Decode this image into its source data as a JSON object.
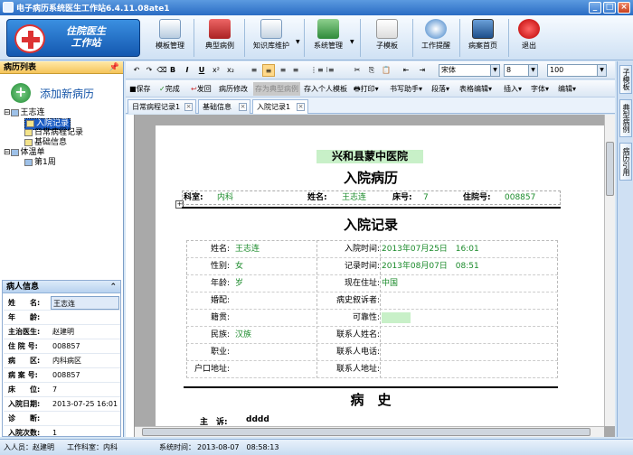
{
  "window": {
    "title": "电子病历系统医生工作站6.4.11.08ate1"
  },
  "logo": {
    "line1": "住院医生",
    "line2": "工作站"
  },
  "ribbon": [
    {
      "label": "模板管理",
      "icon": "template-manage-icon"
    },
    {
      "label": "典型病例",
      "icon": "typical-case-icon"
    },
    {
      "label": "知识库维护",
      "icon": "knowledge-base-icon"
    },
    {
      "label": "系统管理",
      "icon": "system-manage-icon"
    },
    {
      "label": "子模板",
      "icon": "sub-template-icon"
    },
    {
      "label": "工作提醒",
      "icon": "reminder-clock-icon"
    },
    {
      "label": "病案首页",
      "icon": "record-home-icon"
    },
    {
      "label": "退出",
      "icon": "exit-power-icon"
    }
  ],
  "side": {
    "header": "病历列表",
    "add_label": "添加新病历",
    "tree": [
      {
        "label": "王志连",
        "level": 0
      },
      {
        "label": "入院记录",
        "level": 1,
        "selected": true
      },
      {
        "label": "日常病程记录",
        "level": 1
      },
      {
        "label": "基础信息",
        "level": 1
      },
      {
        "label": "体温单",
        "level": 0
      },
      {
        "label": "第1周",
        "level": 1
      }
    ]
  },
  "patient": {
    "header": "病人信息",
    "rows": [
      {
        "k": "姓　　名:",
        "v": "王志连"
      },
      {
        "k": "年　　龄:",
        "v": ""
      },
      {
        "k": "主治医生:",
        "v": "赵建明"
      },
      {
        "k": "住 院 号:",
        "v": "008857"
      },
      {
        "k": "病　　区:",
        "v": "内科病区"
      },
      {
        "k": "病 案 号:",
        "v": "008857"
      },
      {
        "k": "床　　位:",
        "v": "7"
      },
      {
        "k": "入院日期:",
        "v": "2013-07-25 16:01"
      },
      {
        "k": "诊　　断:",
        "v": ""
      },
      {
        "k": "入院次数:",
        "v": "1"
      }
    ]
  },
  "toolbar1": {
    "font": "宋体",
    "size": "8",
    "zoom": "100"
  },
  "toolbar2": [
    "保存",
    "完成",
    "发回",
    "病历修改",
    "存为典型病例",
    "存入个人模板",
    "打印",
    "书写助手",
    "段落",
    "表格编辑",
    "插入",
    "字体",
    "编辑"
  ],
  "tabs": [
    "日常病程记录1",
    "基础信息",
    "入院记录1"
  ],
  "doc": {
    "hospital": "兴和县蒙中医院",
    "title": "入院病历",
    "header": {
      "dept_k": "科室:",
      "dept_v": "内科",
      "name_k": "姓名:",
      "name_v": "王志连",
      "bed_k": "床号:",
      "bed_v": "7",
      "no_k": "住院号:",
      "no_v": "008857"
    },
    "section": "入院记录",
    "fields": [
      {
        "k": "姓名:",
        "v": "王志连",
        "k2": "入院时间:",
        "v2": "2013年07月25日　16:01"
      },
      {
        "k": "性别:",
        "v": "女",
        "k2": "记录时间:",
        "v2": "2013年08月07日　08:51"
      },
      {
        "k": "年龄:",
        "v": "岁",
        "k2": "现在住址:",
        "v2": "中国"
      },
      {
        "k": "婚配:",
        "v": "",
        "k2": "病史叙诉者:",
        "v2": ""
      },
      {
        "k": "籍贯:",
        "v": "",
        "k2": "可靠性:",
        "v2": ""
      },
      {
        "k": "民族:",
        "v": "汉族",
        "k2": "联系人姓名:",
        "v2": ""
      },
      {
        "k": "职业:",
        "v": "",
        "k2": "联系人电话:",
        "v2": ""
      },
      {
        "k": "户口地址:",
        "v": "",
        "k2": "联系人地址:",
        "v2": ""
      }
    ],
    "history_title": "病　史",
    "complaint_k": "主　诉:",
    "complaint_v": "dddd"
  },
  "rdock": [
    "子模板",
    "典型病例",
    "病历引用"
  ],
  "status": {
    "user": "入人员：赵建明",
    "dept": "工作科室：内科",
    "time_k": "系统时间：",
    "time_v": "2013-08-07　08:58:13"
  }
}
